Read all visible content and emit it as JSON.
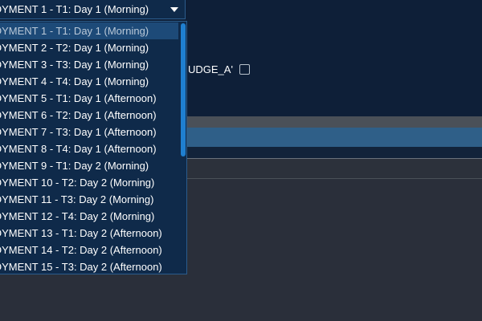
{
  "select": {
    "value": "OYMENT 1 - T1: Day 1 (Morning)"
  },
  "form": {
    "checkbox_label": "UDGE_A'"
  },
  "dropdown": {
    "options": [
      "OYMENT 1 - T1: Day 1 (Morning)",
      "OYMENT 2 - T2: Day 1 (Morning)",
      "OYMENT 3 - T3: Day 1 (Morning)",
      "OYMENT 4 - T4: Day 1 (Morning)",
      "OYMENT 5 - T1: Day 1 (Afternoon)",
      "OYMENT 6 - T2: Day 1 (Afternoon)",
      "OYMENT 7 - T3: Day 1 (Afternoon)",
      "OYMENT 8 - T4: Day 1 (Afternoon)",
      "OYMENT 9 - T1: Day 2 (Morning)",
      "OYMENT 10 - T2: Day 2 (Morning)",
      "OYMENT 11 - T3: Day 2 (Morning)",
      "OYMENT 12 - T4: Day 2 (Morning)",
      "OYMENT 13 - T1: Day 2 (Afternoon)",
      "OYMENT 14 - T2: Day 2 (Afternoon)",
      "OYMENT 15 - T3: Day 2 (Afternoon)"
    ],
    "selected_index": 0
  },
  "colors": {
    "panel": "#0e1f38",
    "dropdown_bg": "#0f2a4a",
    "selected_bg": "#1d4a78",
    "scroll_thumb": "#1f7fd0",
    "page_bg": "#2a2f3a"
  },
  "icons": {
    "caret": "chevron-down-icon"
  }
}
